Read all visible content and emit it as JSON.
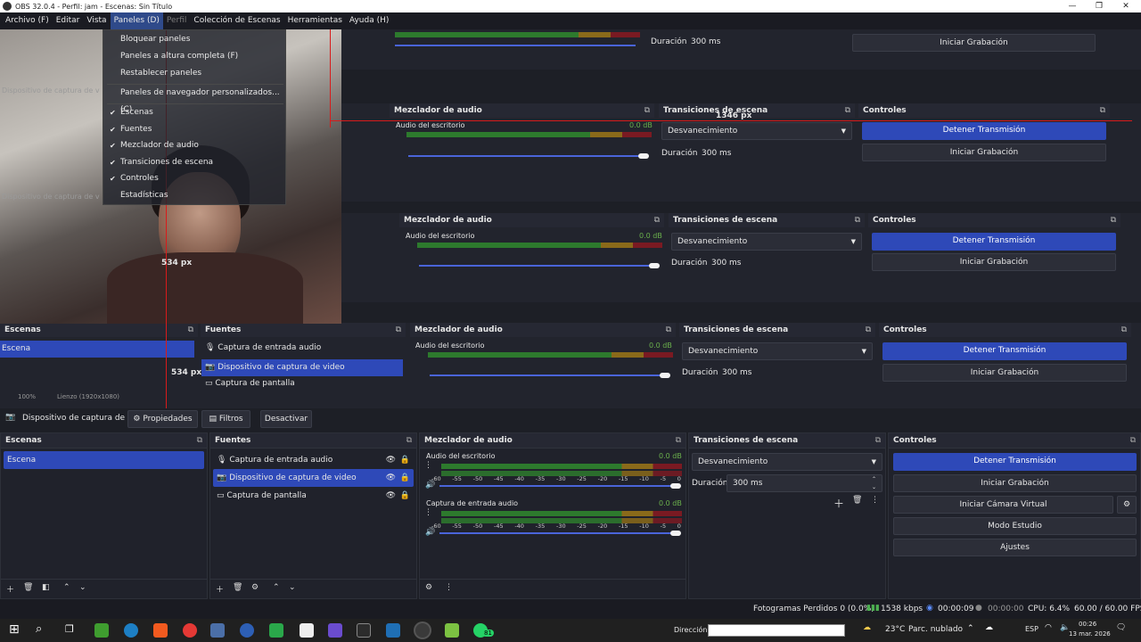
{
  "window": {
    "title": "OBS 32.0.4 - Perfil: jam - Escenas: Sin Título",
    "minimize": "—",
    "maximize": "❐",
    "close": "✕"
  },
  "menu": [
    "Archivo (F)",
    "Editar",
    "Vista",
    "Paneles (D)",
    "Perfil",
    "Colección de Escenas",
    "Herramientas",
    "Ayuda (H)"
  ],
  "panels_menu": {
    "lock": "Bloquear paneles",
    "full_height": "Paneles a altura completa (F)",
    "reset": "Restablecer paneles",
    "custom_browser": "Paneles de navegador personalizados... (C)",
    "scenes": "Escenas",
    "sources": "Fuentes",
    "mixer": "Mezclador de audio",
    "transitions": "Transiciones de escena",
    "controls": "Controles",
    "stats": "Estadísticas"
  },
  "overlay": {
    "width_label": "1346 px",
    "height_label": "534 px",
    "zoom": "100%",
    "canvas": "Lienzo (1920x1080)",
    "webcam_label": "Dispositivo de captura de v"
  },
  "source_toolbar": {
    "source_name": "Dispositivo de captura de v",
    "properties": "Propiedades",
    "filters": "Filtros",
    "deactivate": "Desactivar"
  },
  "docks": {
    "scenes": {
      "title": "Escenas",
      "items": [
        "Escena"
      ]
    },
    "sources": {
      "title": "Fuentes",
      "items": [
        "Captura de entrada audio",
        "Dispositivo de captura de video",
        "Captura de pantalla"
      ]
    },
    "mixer": {
      "title": "Mezclador de audio",
      "channels": [
        {
          "name": "Audio del escritorio",
          "db": "0.0 dB"
        },
        {
          "name": "Captura de entrada audio",
          "db": "0.0 dB"
        }
      ],
      "ticks": [
        "-60",
        "-55",
        "-50",
        "-45",
        "-40",
        "-35",
        "-30",
        "-25",
        "-20",
        "-15",
        "-10",
        "-5",
        "0"
      ]
    },
    "transitions": {
      "title": "Transiciones de escena",
      "type": "Desvanecimiento",
      "duration_label": "Duración",
      "duration": "300 ms"
    },
    "controls": {
      "title": "Controles",
      "stop_stream": "Detener Transmisión",
      "start_record": "Iniciar Grabación",
      "virtual_cam": "Iniciar Cámara Virtual",
      "studio_mode": "Modo Estudio",
      "settings": "Ajustes"
    }
  },
  "status": {
    "dropped": "Fotogramas Perdidos 0 (0.0%)",
    "bitrate": "1538 kbps",
    "stream_time": "00:00:09",
    "rec_time": "00:00:00",
    "cpu": "CPU: 6.4%",
    "fps": "60.00 / 60.00 FPS"
  },
  "taskbar": {
    "address_label": "Dirección",
    "weather_temp": "23°C",
    "weather_text": "Parc. nublado",
    "lang": "ESP",
    "time": "00:26",
    "date": "13 mar. 2026",
    "badge": "81"
  },
  "colors": {
    "accent": "#2e49b8",
    "bg": "#1d1f26",
    "meter_green": "#2d7a2d",
    "meter_yellow": "#8a6a1a",
    "meter_red": "#7a1a22"
  }
}
